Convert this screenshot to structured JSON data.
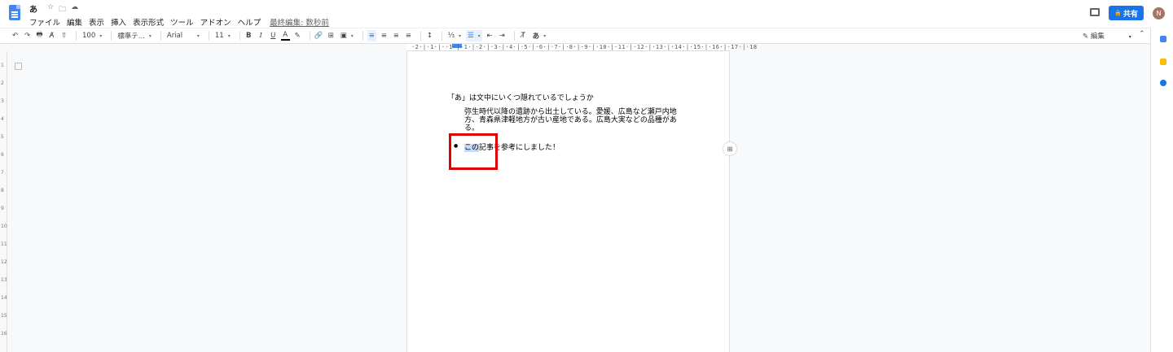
{
  "document": {
    "title": "あ",
    "title_icons": [
      "☆",
      "🗀",
      "☁"
    ]
  },
  "menu": {
    "items": [
      "ファイル",
      "編集",
      "表示",
      "挿入",
      "表示形式",
      "ツール",
      "アドオン",
      "ヘルプ"
    ],
    "last_edit": "最終編集: 数秒前"
  },
  "header": {
    "share_label": "共有",
    "share_icon": "🔒",
    "avatar_initial": "N"
  },
  "toolbar": {
    "undo": "↶",
    "redo": "↷",
    "print": "🖶",
    "spellcheck": "A̸",
    "paint_format": "⇧",
    "zoom": "100",
    "style": "標準テ...",
    "font": "Arial",
    "font_size": "11",
    "bold": "B",
    "italic": "I",
    "underline": "U",
    "text_color": "A",
    "highlight": "✎",
    "link": "🔗",
    "comment": "⊞",
    "image": "▣",
    "align_left": "≡",
    "align_center": "≡",
    "align_right": "≡",
    "justify": "≡",
    "line_spacing": "↕",
    "numbered_list": "⅓",
    "bulleted_list": "☰",
    "decrease_indent": "⇤",
    "increase_indent": "⇥",
    "clear_format": "T̸",
    "input_tools": "あ",
    "edit_mode": "✎ 編集",
    "collapse": "⌃"
  },
  "ruler": {
    "top_numbers": "·2·|·1·|··1·|·1·|·2·|·3·|·4·|·5·|·6·|·7·|·8·|·9·|·10·|·11·|·12·|·13·|·14·|·15·|·16·|·17·|·18",
    "vertical_numbers": [
      "1",
      "2",
      "3",
      "4",
      "5",
      "6",
      "7",
      "8",
      "9",
      "10",
      "11",
      "12",
      "13",
      "14",
      "15",
      "16"
    ]
  },
  "body": {
    "heading": "「あ」は文中にいくつ隠れているでしょうか",
    "paragraph": "弥生時代以降の遺跡から出土している。愛媛、広島など瀬戸内地方、青森県津軽地方が古い産地である。広島大実などの品種がある。",
    "bullet_symbol": "●",
    "bullet_selected": "この",
    "bullet_rest": "記事を参考にしました！"
  },
  "colors": {
    "accent": "#1a73e8",
    "highlight_box": "#e00000",
    "selection": "#c7dbf7"
  }
}
